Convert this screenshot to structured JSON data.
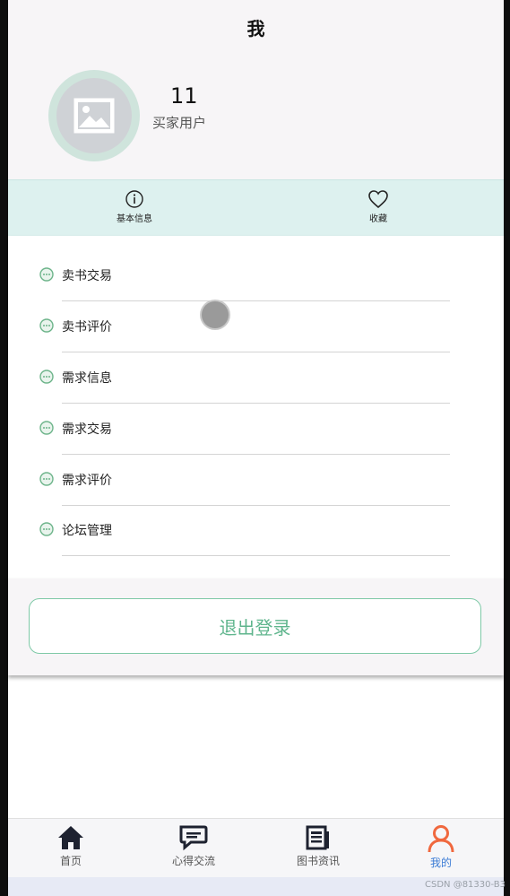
{
  "header": {
    "title": "我",
    "user_id": "11",
    "user_role": "买家用户"
  },
  "info_tabs": [
    {
      "label": "基本信息",
      "icon": "info-circle-icon"
    },
    {
      "label": "收藏",
      "icon": "heart-icon"
    }
  ],
  "menu": [
    {
      "label": "卖书交易",
      "icon": "chat-dots-icon"
    },
    {
      "label": "卖书评价",
      "icon": "chat-dots-icon"
    },
    {
      "label": "需求信息",
      "icon": "chat-dots-icon"
    },
    {
      "label": "需求交易",
      "icon": "chat-dots-icon"
    },
    {
      "label": "需求评价",
      "icon": "chat-dots-icon"
    },
    {
      "label": "论坛管理",
      "icon": "chat-dots-icon"
    }
  ],
  "logout_label": "退出登录",
  "bottom_nav": [
    {
      "label": "首页",
      "icon": "home-icon"
    },
    {
      "label": "心得交流",
      "icon": "comments-icon"
    },
    {
      "label": "图书资讯",
      "icon": "newspaper-icon"
    },
    {
      "label": "我的",
      "icon": "user-icon",
      "active": true
    }
  ],
  "watermark": "CSDN @81330-B3",
  "colors": {
    "accent": "#5fb58d",
    "active_nav_icon": "#f0683e",
    "active_nav_label": "#3a7bd5",
    "info_bar": "#ddf1ef"
  }
}
